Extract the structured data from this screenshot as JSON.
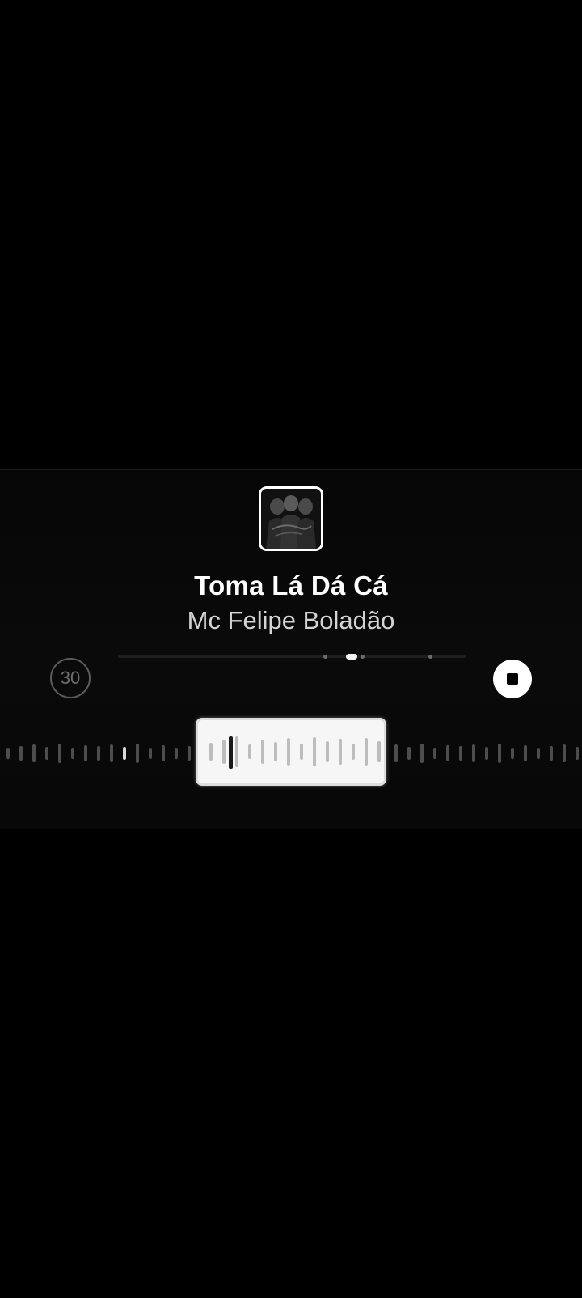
{
  "song": {
    "title": "Toma Lá Dá Cá",
    "artist": "Mc Felipe Boladão"
  },
  "clip_duration": "30",
  "progress": {
    "current_fraction": 0.66
  },
  "colors": {
    "background": "#000000",
    "panel": "#080808",
    "accent": "#ffffff",
    "bar_inactive": "#4d4d4d",
    "bar_selected": "#bdbdbd",
    "playhead": "#1a1a1a"
  },
  "icons": {
    "stop": "stop-icon",
    "album": "album-art-image"
  }
}
